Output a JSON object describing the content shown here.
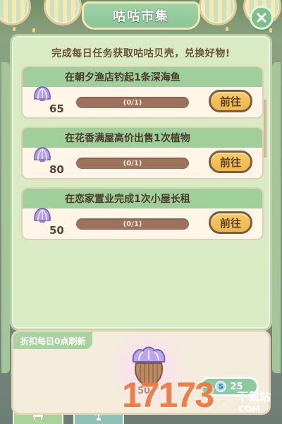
{
  "title": "咕咕市集",
  "subtitle": "完成每日任务获取咕咕贝壳，兑换好物!",
  "tasks": [
    {
      "label": "在朝夕渔店钓起1条深海鱼",
      "reward": "65",
      "progress_text": "(0/1)",
      "progress_fraction": 0,
      "button_label": "前往"
    },
    {
      "label": "在花香满屋高价出售1次植物",
      "reward": "80",
      "progress_text": "(0/1)",
      "progress_fraction": 0,
      "button_label": "前往"
    },
    {
      "label": "在恋家置业完成1次小屋长租",
      "reward": "50",
      "progress_text": "(0/1)",
      "progress_fraction": 0,
      "button_label": "前往"
    }
  ],
  "shop": {
    "refresh_label": "折扣每日0点刷新",
    "item_price": "50",
    "coin_price": "25"
  },
  "colors": {
    "accent_green": "#9fcf9b",
    "button_yellow": "#f7cb63",
    "shell_purple": "#b39ae8"
  },
  "watermark": {
    "main": "17173",
    "dot": ".",
    "com": "COM",
    "site": "下载站"
  }
}
